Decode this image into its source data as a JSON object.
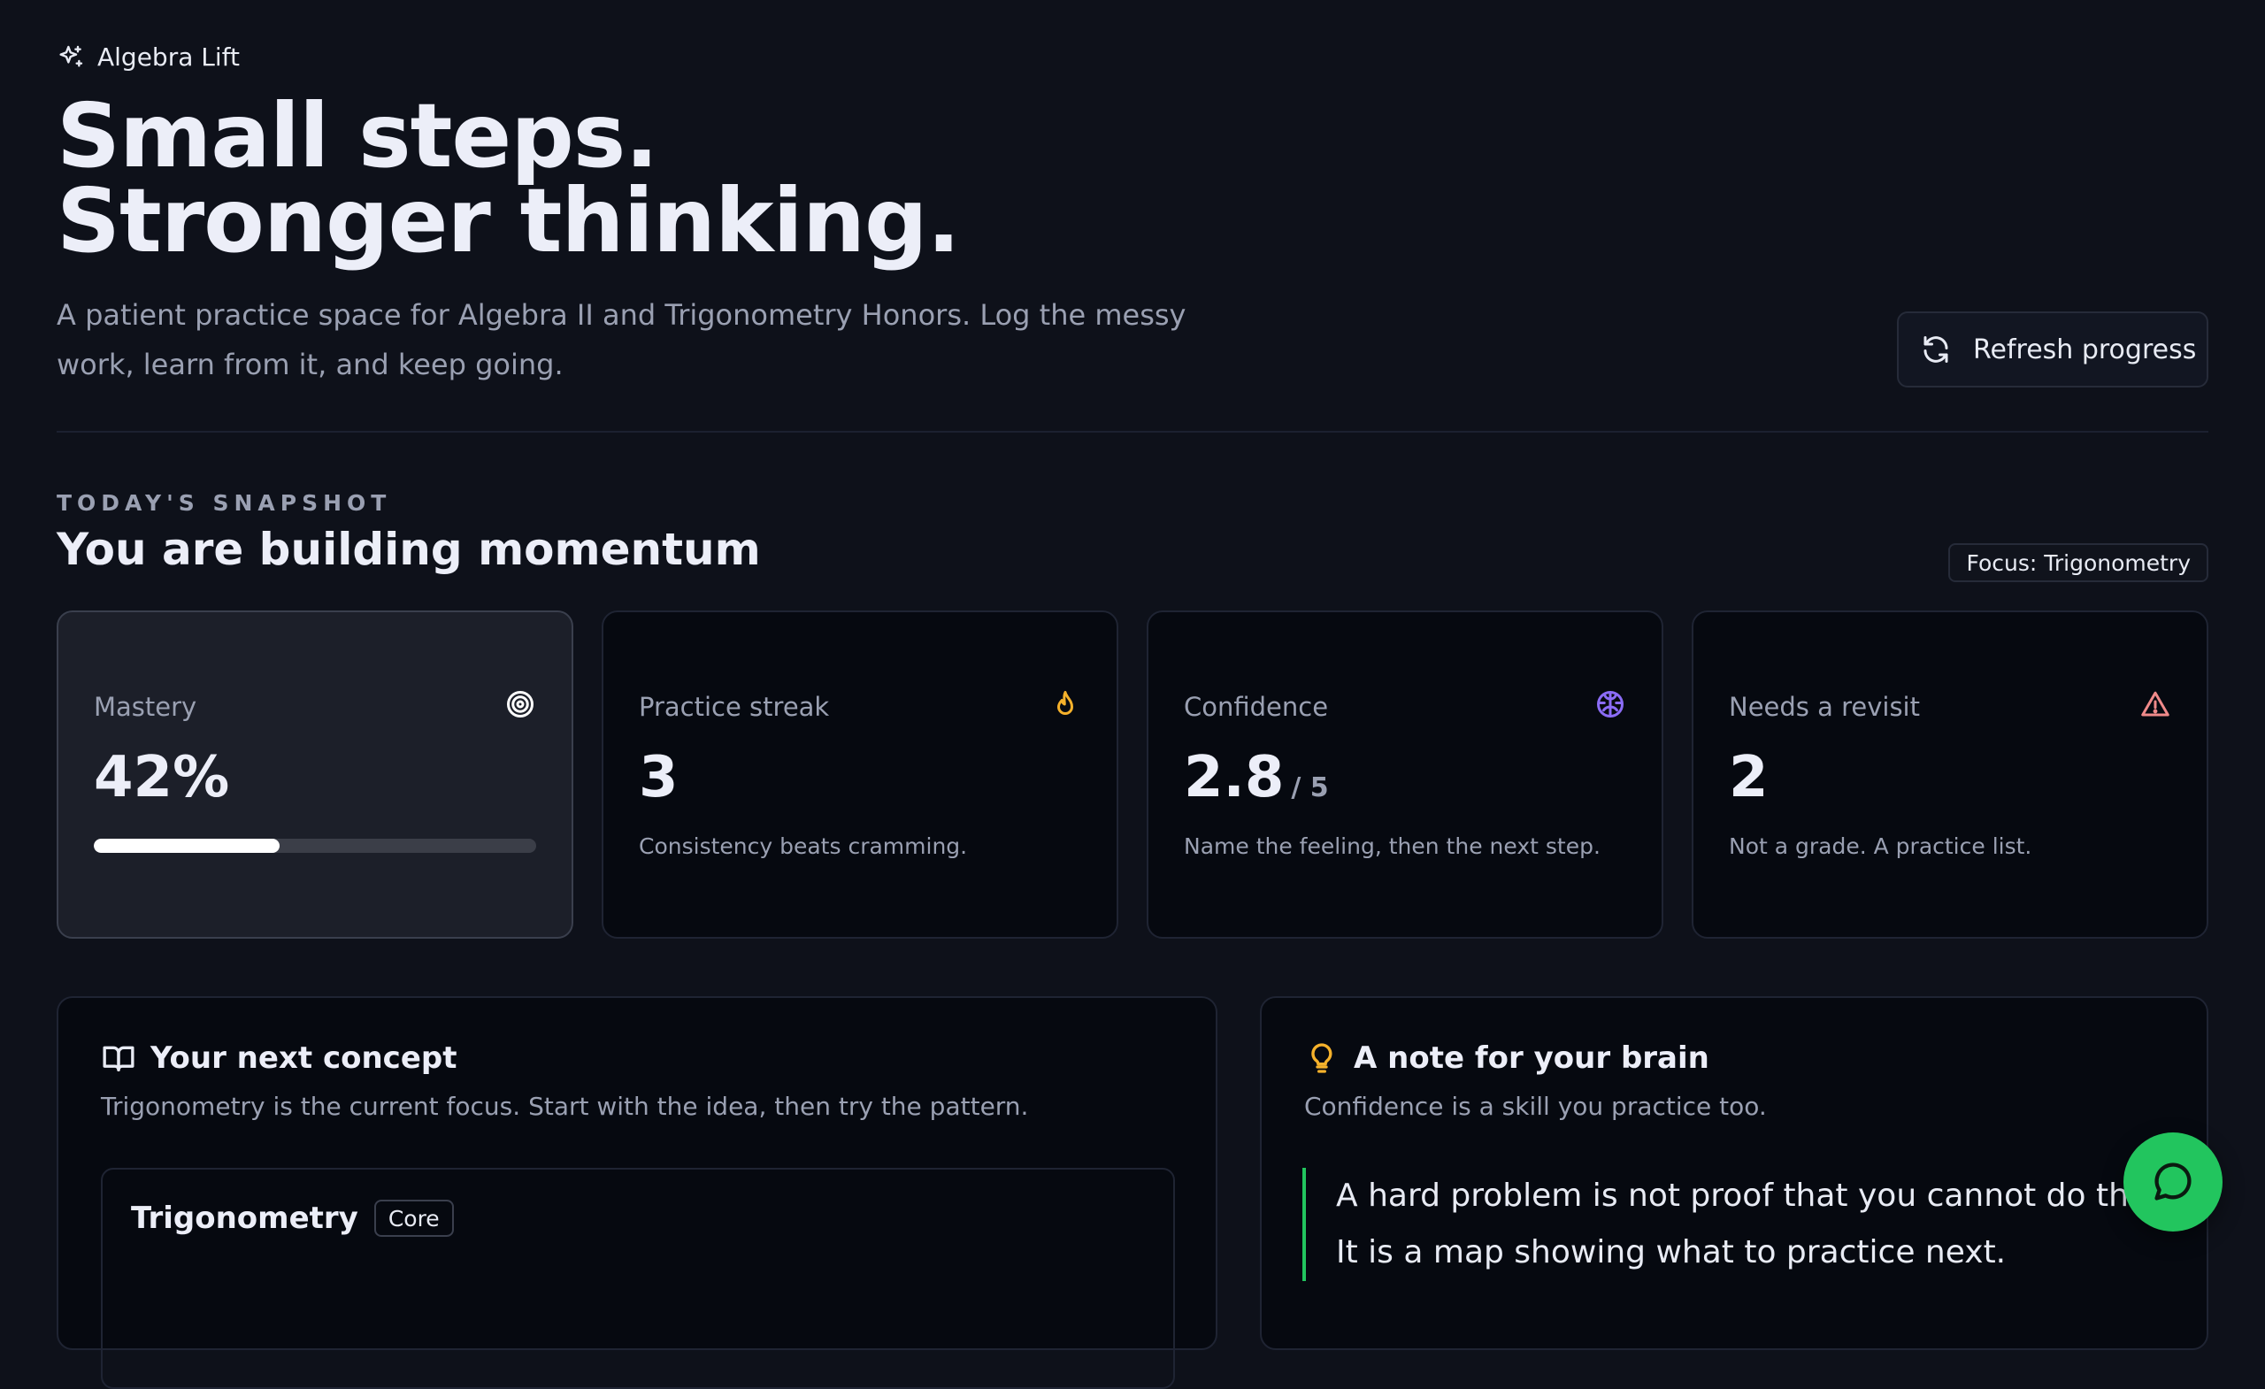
{
  "brand": {
    "name": "Algebra Lift",
    "icon": "sparkles-icon"
  },
  "hero": {
    "title_line1": "Small steps.",
    "title_line2": "Stronger thinking.",
    "subtitle": "A patient practice space for Algebra II and Trigonometry Honors. Log the messy work, learn from it, and keep going."
  },
  "actions": {
    "refresh_label": "Refresh progress",
    "refresh_icon": "refresh-icon"
  },
  "snapshot": {
    "eyebrow": "TODAY'S SNAPSHOT",
    "title": "You are building momentum",
    "focus_badge": "Focus: Trigonometry"
  },
  "cards": [
    {
      "label": "Mastery",
      "value": "42%",
      "progress": 0.42,
      "icon": "target-icon",
      "icon_color": "#ffffff"
    },
    {
      "label": "Practice streak",
      "value": "3",
      "desc": "Consistency beats cramming.",
      "icon": "flame-icon",
      "icon_color": "#f5b12b"
    },
    {
      "label": "Confidence",
      "value": "2.8",
      "suffix": "/ 5",
      "desc": "Name the feeling, then the next step.",
      "icon": "brain-icon",
      "icon_color": "#8b6cf6"
    },
    {
      "label": "Needs a revisit",
      "value": "2",
      "desc": "Not a grade. A practice list.",
      "icon": "alert-triangle-icon",
      "icon_color": "#f08a8a"
    }
  ],
  "next_concept": {
    "title": "Your next concept",
    "subtitle": "Trigonometry is the current focus. Start with the idea, then try the pattern.",
    "concept_title": "Trigonometry",
    "concept_tag": "Core"
  },
  "brain_note": {
    "title": "A note for your brain",
    "subtitle": "Confidence is a skill you practice too.",
    "quote_line1": "A hard problem is not proof that you cannot do this.",
    "quote_line2": "It is a map showing what to practice next."
  },
  "colors": {
    "accent": "#22c55e",
    "background": "#0e111a"
  }
}
